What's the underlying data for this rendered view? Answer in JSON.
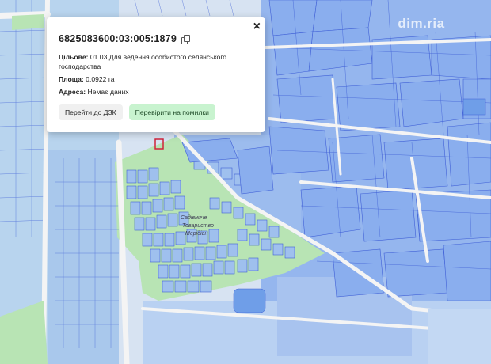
{
  "popup": {
    "cadastral_number": "6825083600:03:005:1879",
    "purpose_label": "Цільове:",
    "purpose_value": "01.03 Для ведення особистого селянського господарства",
    "area_label": "Площа:",
    "area_value": "0.0922 га",
    "address_label": "Адреса:",
    "address_value": "Немає даних",
    "btn_registry": "Перейти до ДЗК",
    "btn_check": "Перевірити на помилки",
    "close_symbol": "×"
  },
  "map": {
    "area_label_line1": "Садівниче",
    "area_label_line2": "Товариство",
    "area_label_line3": "Мерідіан",
    "colors": {
      "background": "#e9eef4",
      "parcel_fill": "#9fc0ee",
      "parcel_dark": "#7ea4e6",
      "parcel_stroke": "#3f5fd6",
      "road": "#f2f2f2",
      "green": "#b8e4b4",
      "water": "#6f9ee8",
      "selected": "#d0233a"
    }
  },
  "watermark": "dim.ria"
}
